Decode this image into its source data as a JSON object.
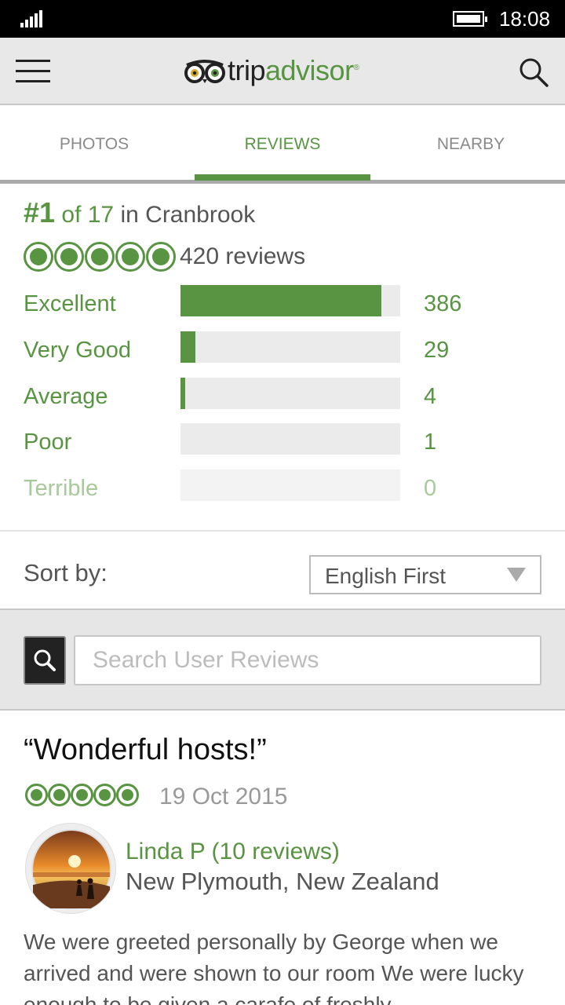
{
  "status_bar": {
    "time": "18:08"
  },
  "header": {
    "logo_trip": "trip",
    "logo_advisor": "advisor",
    "logo_mark": "®"
  },
  "tabs": [
    {
      "label": "PHOTOS",
      "active": false
    },
    {
      "label": "REVIEWS",
      "active": true
    },
    {
      "label": "NEARBY",
      "active": false
    }
  ],
  "ranking": {
    "rank": "#1",
    "of_text": "of 17",
    "in_text": "in Cranbrook"
  },
  "overall": {
    "bubbles": 5,
    "reviews": "420 reviews"
  },
  "ratings": [
    {
      "label": "Excellent",
      "count": "386",
      "fraction": 0.914
    },
    {
      "label": "Very Good",
      "count": "29",
      "fraction": 0.069
    },
    {
      "label": "Average",
      "count": "4",
      "fraction": 0.01
    },
    {
      "label": "Poor",
      "count": "1",
      "fraction": 0
    },
    {
      "label": "Terrible",
      "count": "0",
      "fraction": 0
    }
  ],
  "sort": {
    "label": "Sort by:",
    "selected": "English First"
  },
  "search": {
    "placeholder": "Search User Reviews"
  },
  "review": {
    "title": "“Wonderful hosts!”",
    "bubbles": 5,
    "date": "19 Oct 2015",
    "reviewer": "Linda P (10 reviews)",
    "location": "New Plymouth, New Zealand",
    "body": "We were greeted personally by George when we arrived and were shown to our room We were lucky enough to be given a carafe of freshly"
  },
  "colors": {
    "accent": "#589442",
    "status_bar": "#000000",
    "header_bg": "#e8e8e8"
  },
  "icons": [
    "signal-icon",
    "battery-icon",
    "hamburger-menu-icon",
    "tripadvisor-owl-logo",
    "search-icon"
  ]
}
